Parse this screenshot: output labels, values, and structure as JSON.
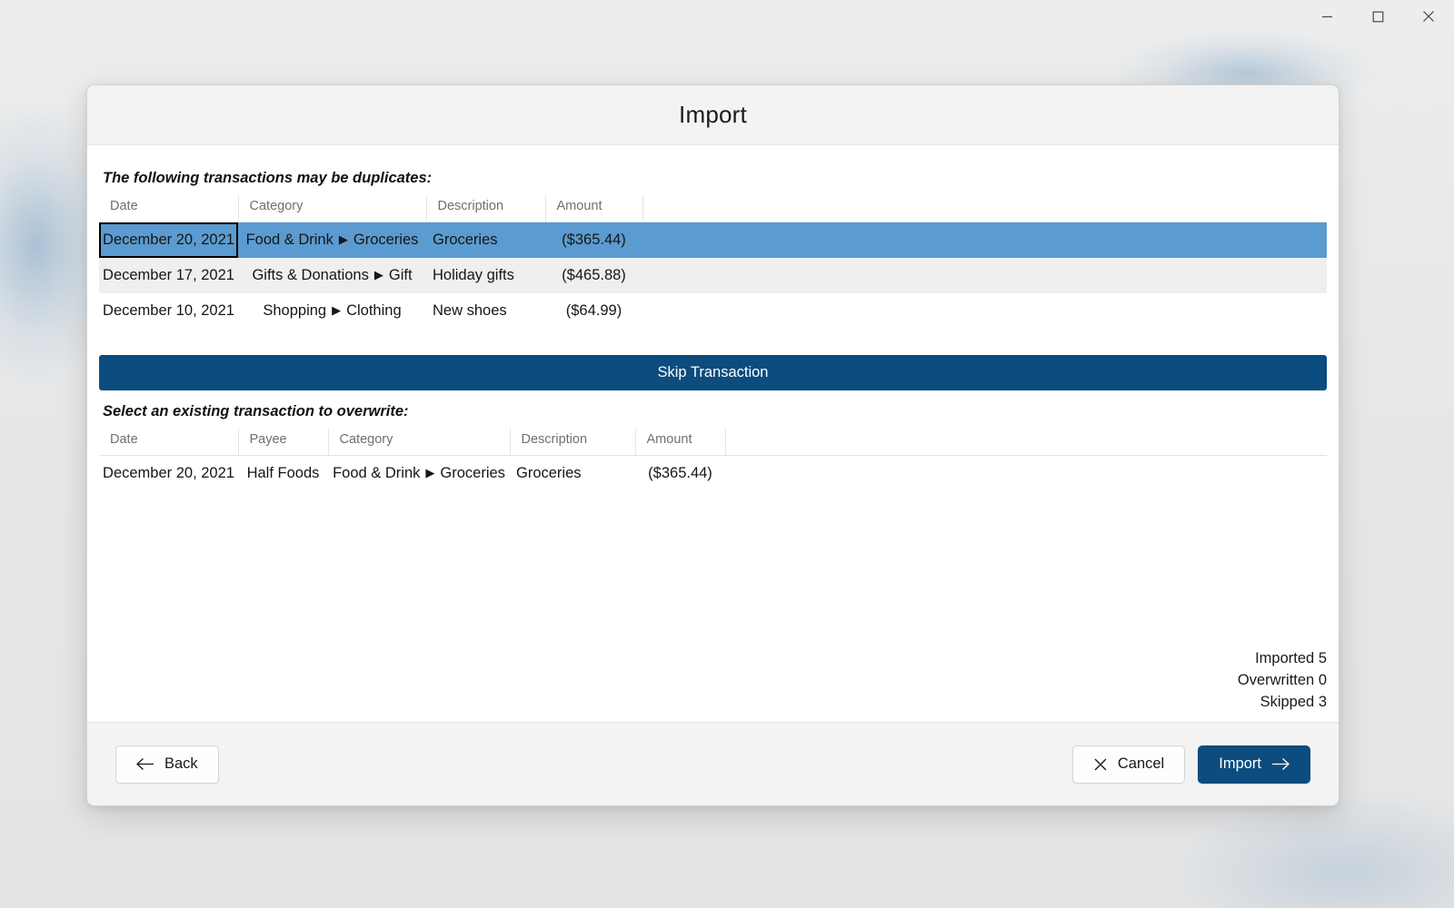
{
  "window_controls": [
    {
      "name": "minimize-button",
      "icon": "minimize-icon",
      "label": "Minimize"
    },
    {
      "name": "maximize-button",
      "icon": "maximize-icon",
      "label": "Maximize"
    },
    {
      "name": "close-button",
      "icon": "close-icon",
      "label": "Close"
    }
  ],
  "dialog": {
    "title": "Import",
    "duplicates_section": {
      "heading": "The following transactions may be duplicates:",
      "columns": [
        "Date",
        "Category",
        "Description",
        "Amount"
      ],
      "rows": [
        {
          "date": "December 20, 2021",
          "category_parent": "Food & Drink",
          "category_arrow": "▶",
          "category_child": "Groceries",
          "description": "Groceries",
          "amount": "($365.44)",
          "selected": true,
          "focused": true
        },
        {
          "date": "December 17, 2021",
          "category_parent": "Gifts & Donations",
          "category_arrow": "▶",
          "category_child": "Gift",
          "description": "Holiday gifts",
          "amount": "($465.88)",
          "selected": false,
          "focused": false
        },
        {
          "date": "December 10, 2021",
          "category_parent": "Shopping",
          "category_arrow": "▶",
          "category_child": "Clothing",
          "description": "New shoes",
          "amount": "($64.99)",
          "selected": false,
          "focused": false
        }
      ]
    },
    "skip_transaction_label": "Skip Transaction",
    "overwrite_section": {
      "heading": "Select an existing transaction to overwrite:",
      "columns": [
        "Date",
        "Payee",
        "Category",
        "Description",
        "Amount"
      ],
      "rows": [
        {
          "date": "December 20, 2021",
          "payee": "Half Foods",
          "category_parent": "Food & Drink",
          "category_arrow": "▶",
          "category_child": "Groceries",
          "description": "Groceries",
          "amount": "($365.44)"
        }
      ]
    },
    "counters": [
      {
        "label": "Imported",
        "value": "5"
      },
      {
        "label": "Overwritten",
        "value": "0"
      },
      {
        "label": "Skipped",
        "value": "3"
      }
    ],
    "footer": {
      "back_label": "Back",
      "back_icon": "arrow-left-icon",
      "cancel_label": "Cancel",
      "cancel_icon": "close-x-icon",
      "import_label": "Import",
      "import_icon": "arrow-right-icon"
    }
  },
  "colors": {
    "accent_navy": "#0c4c7e",
    "selection_blue": "#5b9bd1",
    "alt_row": "#efefef",
    "chrome_gray": "#f3f3f3",
    "desktop_gray": "#e8e8e8"
  }
}
